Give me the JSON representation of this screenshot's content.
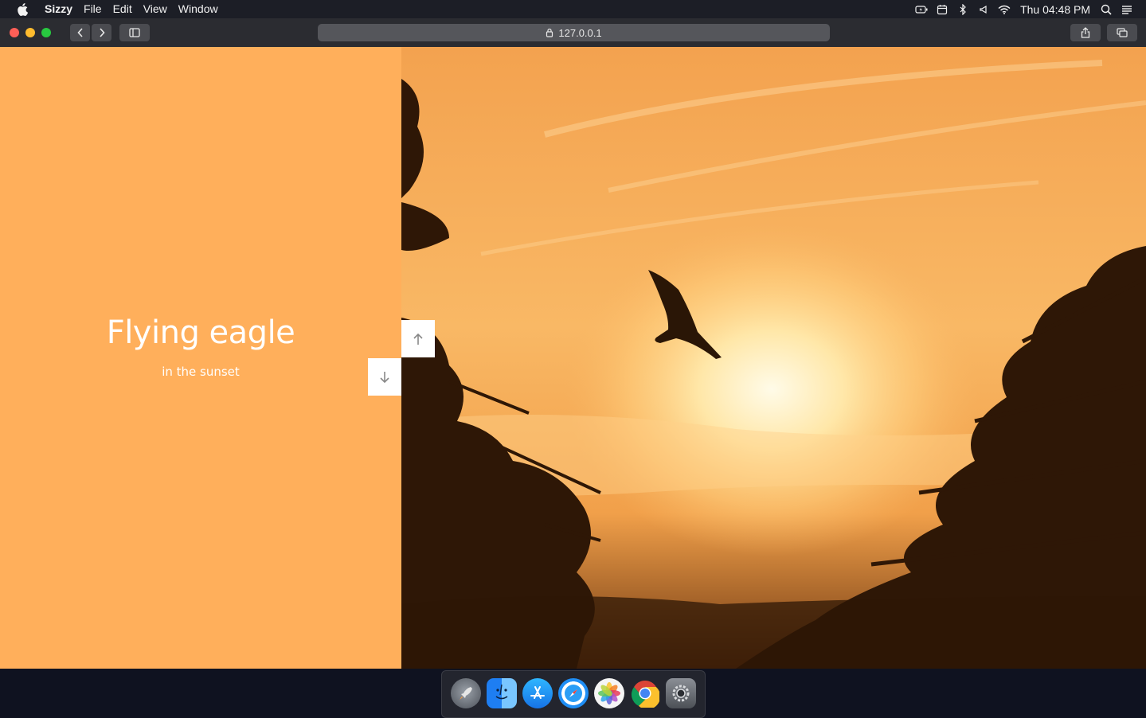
{
  "menubar": {
    "app_name": "Sizzy",
    "menus": [
      "File",
      "Edit",
      "View",
      "Window"
    ],
    "clock": "Thu 04:48 PM",
    "status_icons": [
      "battery-icon",
      "calendar-icon",
      "bluetooth-icon",
      "volume-icon",
      "wifi-icon",
      "spotlight-icon",
      "notification-center-icon"
    ]
  },
  "toolbar": {
    "url": "127.0.0.1",
    "icons": [
      "back-icon",
      "forward-icon",
      "sidebar-icon",
      "lock-icon",
      "share-icon",
      "tabs-icon"
    ]
  },
  "page": {
    "title": "Flying eagle",
    "subtitle": "in the sunset",
    "panel_color": "#ffaf5b"
  },
  "dock": {
    "apps": [
      "launchpad-icon",
      "finder-icon",
      "app-store-icon",
      "safari-icon",
      "photos-icon",
      "chrome-icon",
      "system-preferences-icon"
    ]
  }
}
